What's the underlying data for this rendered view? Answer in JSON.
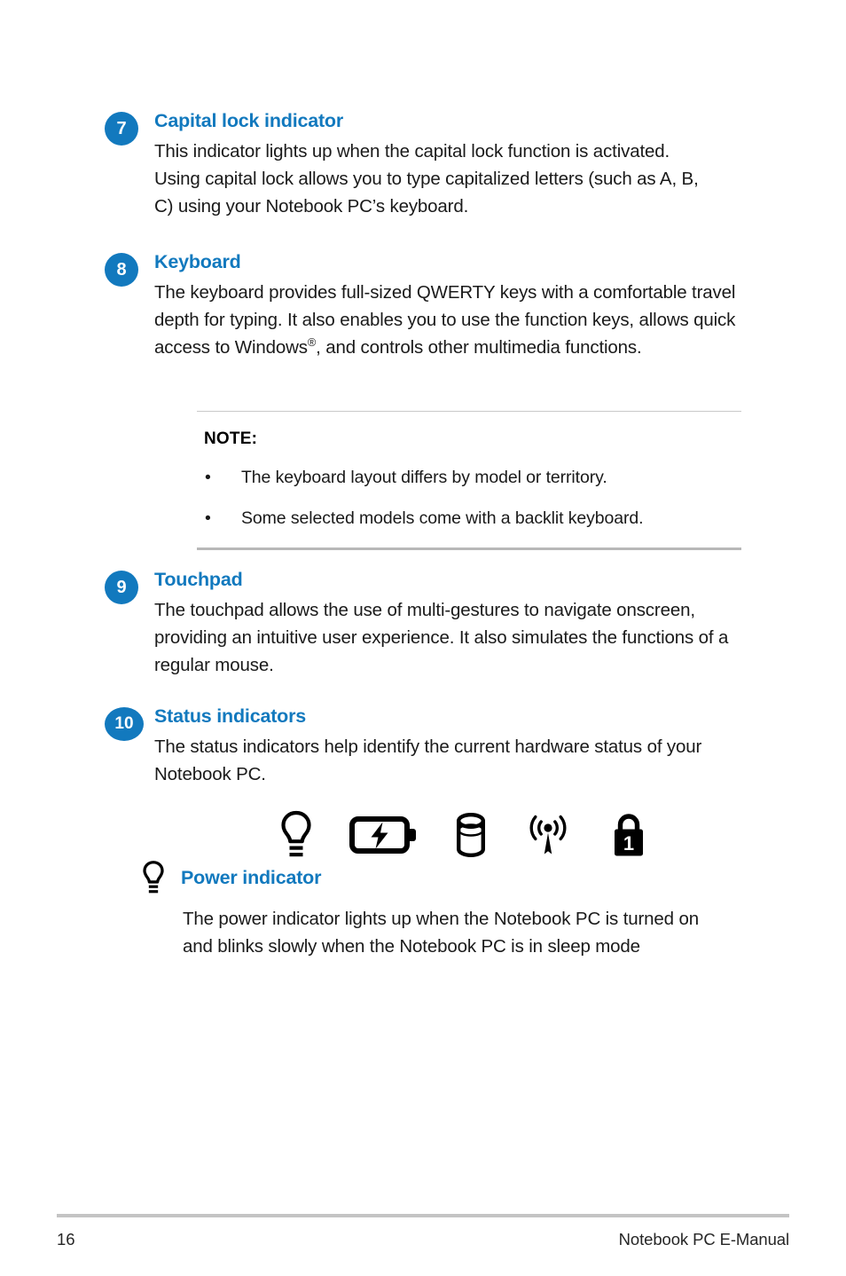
{
  "page": {
    "number": "16",
    "footer_title": "Notebook PC E-Manual",
    "accent_color": "#1279be",
    "background_color": "#ffffff"
  },
  "sections": [
    {
      "number": "7",
      "title": "Capital lock indicator",
      "text": "This indicator lights up when the capital lock function is activated. Using capital lock allows you to type capitalized letters (such as A, B, C) using your Notebook PC’s keyboard."
    },
    {
      "number": "8",
      "title": "Keyboard",
      "text_part1": "The keyboard provides full-sized QWERTY keys with a comfortable travel depth for typing. It also enables you to use the function keys, allows quick access to Windows",
      "text_sup": "®",
      "text_part2": ", and controls other multimedia functions."
    },
    {
      "number": "9",
      "title": "Touchpad",
      "text": "The touchpad allows the use of multi-gestures to navigate onscreen, providing an intuitive user experience. It also simulates the functions of a regular mouse."
    },
    {
      "number": "10",
      "title": "Status indicators",
      "text": "The status indicators help identify the current hardware status of your Notebook PC."
    }
  ],
  "note": {
    "label": "NOTE:",
    "bullet_glyph": "•",
    "items": [
      "The keyboard layout differs by model or territory.",
      "Some selected models come with a backlit keyboard."
    ]
  },
  "status_indicator_icons": [
    {
      "name": "power-indicator-icon",
      "label": "Power indicator"
    },
    {
      "name": "battery-charge-indicator-icon",
      "label": "Two-color battery charge indicator"
    },
    {
      "name": "drive-activity-indicator-icon",
      "label": "Drive activity indicator"
    },
    {
      "name": "wireless-bluetooth-indicator-icon",
      "label": "Bluetooth / Wireless indicator"
    },
    {
      "name": "capital-lock-indicator-icon",
      "label": "Capital lock indicator"
    }
  ],
  "power_indicator": {
    "icon_name": "power-indicator-icon",
    "title": "Power indicator",
    "text": "The power indicator lights up when the Notebook PC is turned on and blinks slowly when the Notebook PC is in sleep mode"
  }
}
